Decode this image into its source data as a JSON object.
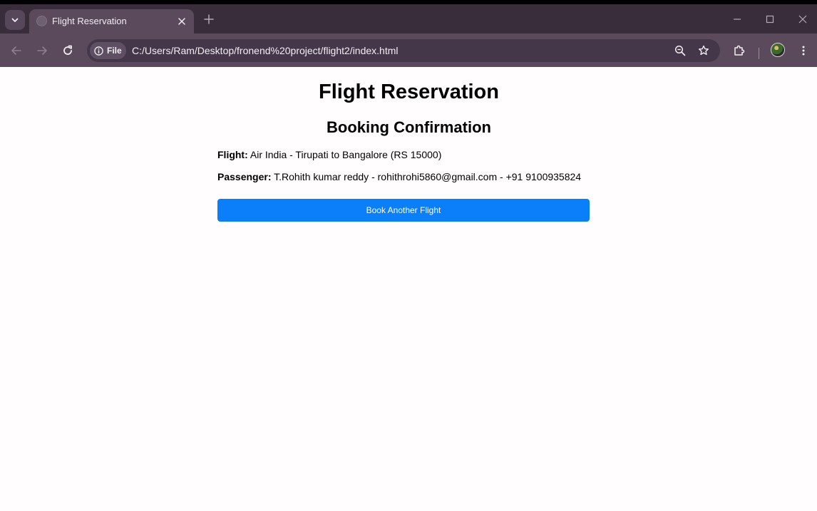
{
  "browser": {
    "tab_title": "Flight Reservation",
    "site_chip_label": "File",
    "url": "C:/Users/Ram/Desktop/fronend%20project/flight2/index.html",
    "theme_colors": {
      "frame": "#3a2d3b",
      "toolbar": "#5a4a5c",
      "omnibox": "#45374a"
    }
  },
  "page": {
    "title": "Flight Reservation",
    "subtitle": "Booking Confirmation",
    "flight_label": "Flight:",
    "flight_value": " Air India - Tirupati to Bangalore (RS 15000)",
    "passenger_label": "Passenger:",
    "passenger_value": " T.Rohith kumar reddy - rohithrohi5860@gmail.com - +91 9100935824",
    "button_label": "Book Another Flight",
    "button_color": "#0a7ff9"
  }
}
